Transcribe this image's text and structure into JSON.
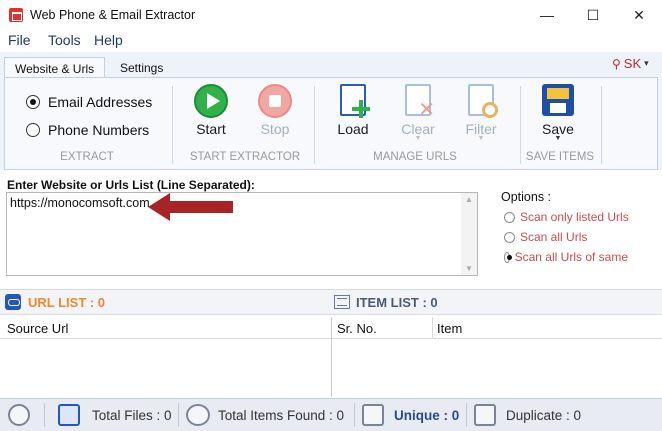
{
  "window": {
    "title": "Web Phone & Email Extractor",
    "min": "—",
    "max": "☐",
    "close": "✕"
  },
  "menu": [
    "File",
    "Tools",
    "Help"
  ],
  "tabs": [
    "Website & Urls",
    "Settings"
  ],
  "user": {
    "label": "SK",
    "caret": "▾"
  },
  "extract": {
    "options": [
      "Email Addresses",
      "Phone Numbers"
    ],
    "selected": "Email Addresses",
    "group_label": "EXTRACT"
  },
  "start_extractor": {
    "start_label": "Start",
    "stop_label": "Stop",
    "group_label": "START EXTRACTOR"
  },
  "manage_urls": {
    "load_label": "Load",
    "clear_label": "Clear",
    "filter_label": "Filter",
    "group_label": "MANAGE URLS"
  },
  "save_items": {
    "save_label": "Save",
    "group_label": "SAVE ITEMS"
  },
  "input": {
    "label": "Enter Website or Urls List (Line Separated):",
    "value": "https://monocomsoft.com"
  },
  "options": {
    "title": "Options :",
    "items": [
      "Scan only listed Urls",
      "Scan all Urls",
      "Scan all Urls of same"
    ],
    "selected": "Scan all Urls of same"
  },
  "url_list": {
    "title": "URL LIST : 0",
    "columns": [
      "Source Url"
    ]
  },
  "item_list": {
    "title": "ITEM LIST : 0",
    "columns": [
      "Sr. No.",
      "Item"
    ]
  },
  "status": {
    "total_files": "Total Files : 0",
    "total_items": "Total Items Found : 0",
    "unique": "Unique : 0",
    "duplicate": "Duplicate : 0"
  },
  "colors": {
    "accent_orange": "#f0882e",
    "option_red": "#c94d4d",
    "start_green": "#2fb24a",
    "arrow_red": "#a82424"
  }
}
